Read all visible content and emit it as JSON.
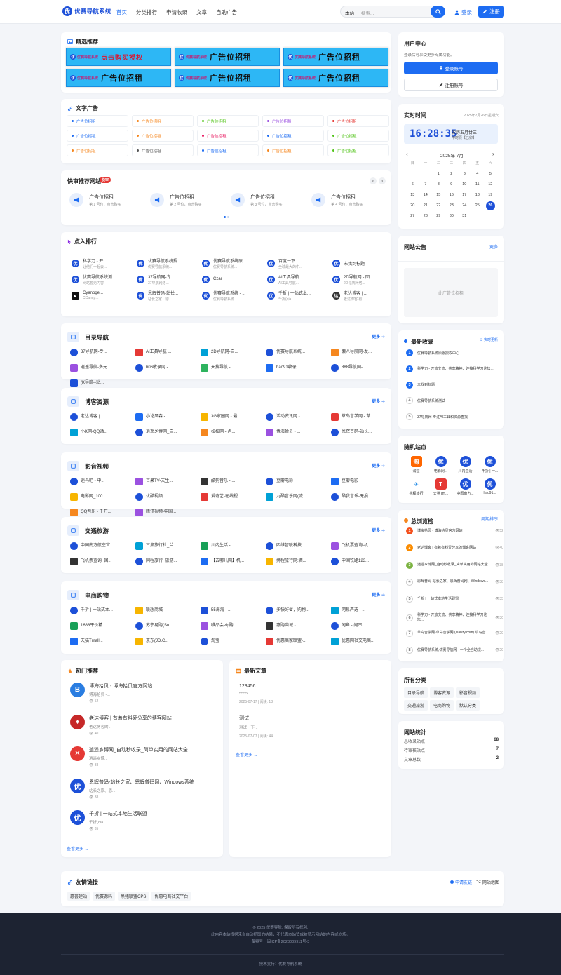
{
  "brand": {
    "name": "优赛导航系统",
    "icon": "优"
  },
  "nav": [
    "首页",
    "分类排行",
    "申请收录",
    "文章",
    "自助广告"
  ],
  "search": {
    "site": "本站",
    "placeholder": "搜索..."
  },
  "user": {
    "login": "登录",
    "register": "注册"
  },
  "featured": {
    "title": "精选推荐",
    "banners": [
      {
        "mini": "优赛导航系统",
        "text": "点击购买授权",
        "red": true
      },
      {
        "mini": "优赛导航系统",
        "text": "广告位招租"
      },
      {
        "mini": "优赛导航系统",
        "text": "广告位招租"
      },
      {
        "mini": "优赛导航系统",
        "text": "广告位招租"
      },
      {
        "mini": "优赛导航系统",
        "text": "广告位招租"
      },
      {
        "mini": "优赛导航系统",
        "text": "广告位招租"
      }
    ]
  },
  "textads": {
    "title": "文字广告",
    "label": "广告位招租",
    "dots": [
      "#1d6cf2",
      "#f5871f",
      "#52c41a",
      "#9b51e0",
      "#e53935",
      "#1d6cf2",
      "#f5871f",
      "#e91e63",
      "#1d6cf2",
      "#52c41a",
      "#f5871f",
      "#555",
      "#1d6cf2",
      "#f5871f",
      "#52c41a"
    ]
  },
  "quick": {
    "title": "快审推荐网站",
    "badge": "快审",
    "items": [
      {
        "t": "广告位招租",
        "s": "第 1 号位，点击购买"
      },
      {
        "t": "广告位招租",
        "s": "第 2 号位，点击购买"
      },
      {
        "t": "广告位招租",
        "s": "第 3 号位，点击购买"
      },
      {
        "t": "广告位招租",
        "s": "第 4 号位，点击购买"
      }
    ]
  },
  "rank": {
    "title": "点入排行",
    "items": [
      {
        "t": "科学刀 - 开...",
        "s": "让他们一起去..."
      },
      {
        "t": "优赛导航系统授...",
        "s": "优赛导航系统..."
      },
      {
        "t": "优赛导航系统原...",
        "s": "优赛导航系统..."
      },
      {
        "t": "百度一下",
        "s": "全球最大的中..."
      },
      {
        "t": "未找到标题",
        "s": ""
      },
      {
        "t": "优赛导航系统测...",
        "s": "网站暂无内容"
      },
      {
        "t": "37导航网-专...",
        "s": "37导航网络..."
      },
      {
        "t": "Czar",
        "s": ""
      },
      {
        "t": "AI工具导航 ...",
        "s": "AI工具导航..."
      },
      {
        "t": "2D导航网 - 回...",
        "s": "2D导航网络..."
      },
      {
        "t": "Cyanoge...",
        "s": "CCam p..."
      },
      {
        "t": "恩辉普码-站长...",
        "s": "站长之家、恩..."
      },
      {
        "t": "优赛导航系统 - ...",
        "s": "优赛导航系统..."
      },
      {
        "t": "千折 | 一站式本...",
        "s": "千折(qia..."
      },
      {
        "t": "老达博客 | ...",
        "s": "老达博客 有..."
      }
    ]
  },
  "sections": [
    {
      "title": "目录导航",
      "more": "更多",
      "items": [
        "37导航网-专...",
        "AI工具导航 ...",
        "2D导航网-自...",
        "优赛导航系统...",
        "懒人导航网-发...",
        "逍遥导航-多元...",
        "606收录网 - ...",
        "天搜导航 - ...",
        "hao91收录...",
        "888导航网-...",
        "(K导航--站..."
      ]
    },
    {
      "title": "博客资源",
      "more": "更多",
      "items": [
        "老达博客 | ...",
        "小论风森 - ...",
        "3G家园网 - 最...",
        "活动资讯网 - ...",
        "草岛音学网 - 草...",
        "小K网-QQ活...",
        "逍遥乡博网_自...",
        "松松网 - 卢...",
        "博海拾贝 - ...",
        "恩辉普码-站长..."
      ]
    },
    {
      "title": "影音视频",
      "more": "更多",
      "items": [
        "迷鸟吧 - 中...",
        "芒果TV-天生...",
        "酷狗音乐 - ...",
        "豆瓣电影",
        "豆瓣电影",
        "电影网_100...",
        "优酷视频",
        "爱奇艺-在线视...",
        "九酷音乐网(流...",
        "酷我音乐-无损...",
        "QQ音乐 - 千万...",
        "腾讯视频-中国..."
      ]
    },
    {
      "title": "交通旅游",
      "more": "更多",
      "items": [
        "中国南方航空官...",
        "甘肃旅行社_兰...",
        "川内生活 - ...",
        "四维智联科技",
        "飞机票查询-机...",
        "飞机票查询_国...",
        "同程旅行_旅游...",
        "【去哪儿网】机...",
        "携程旅行网:酒...",
        "中国铁路123..."
      ]
    },
    {
      "title": "电商购物",
      "more": "更多",
      "items": [
        "千折 | 一站式本...",
        "联想商城",
        "55海淘 - ...",
        "多快好省，购物...",
        "网易严选 - ...",
        "1688平价精...",
        "苏宁易购(Su...",
        "唯品会vip购...",
        "惠购商城 - ...",
        "闲鱼 - 闲不...",
        "天猫Tmall...",
        "京东(JD.C...",
        "淘宝",
        "优惠商家联盟-...",
        "优惠网社交电商..."
      ]
    }
  ],
  "hot": {
    "title": "热门推荐",
    "more": "查看更多 →",
    "items": [
      {
        "t": "博海拾贝 - 博海拾贝官方网站",
        "s": "博海拾贝 -...",
        "v": "52"
      },
      {
        "t": "老达博客 | 有着有料爱分享的博客网站",
        "s": "老达博客的...",
        "v": "40"
      },
      {
        "t": "逍遥乡博网_自动秒收录_简单实用的网站大全",
        "s": "逍遥乡博...",
        "v": "38"
      },
      {
        "t": "恩辉普码-站长之家、恩辉普码网、Windows系统",
        "s": "站长之家、恩...",
        "v": "38"
      },
      {
        "t": "千折 | 一站式本地生活联盟",
        "s": "千折(qia...",
        "v": "35"
      }
    ]
  },
  "articles": {
    "title": "最新文章",
    "more": "查看更多 →",
    "items": [
      {
        "t": "123456",
        "s": "5555...",
        "d": "2025-07-17",
        "r": "阅读: 18"
      },
      {
        "t": "测试",
        "s": "测试一下...",
        "d": "2025-07-07",
        "r": "阅读: 44"
      }
    ]
  },
  "usercenter": {
    "title": "用户中心",
    "desc": "登录后可享受更多专属功能。",
    "login": "登录账号",
    "register": "注册账号"
  },
  "clock": {
    "title": "实时时间",
    "date": "2025年7月26日星期六",
    "time": "16:28:35",
    "lunar": "农历五月廿三",
    "shi": "申时辰【己卯】",
    "month": "2025年 7月",
    "weekdays": [
      "日",
      "一",
      "二",
      "三",
      "四",
      "五",
      "六"
    ],
    "today": 26
  },
  "notice": {
    "title": "网站公告",
    "more": "更多",
    "ad": "此广告位招租"
  },
  "latest": {
    "title": "最新收录",
    "refresh": "实时更新",
    "items": [
      "优赛导航系统原版授权中心",
      "科学刀 - 开放交流、共享精神、连接科学刀论坛...",
      "未找到标题",
      "优赛导航系统测试",
      "37导航网-专注AI工具和资源查找"
    ]
  },
  "random": {
    "title": "随机站点",
    "items": [
      "淘宝",
      "电影网...",
      "川内生活",
      "千折 | 一...",
      "携程旅行",
      "天猫Tm...",
      "中国南方...",
      "hao91..."
    ]
  },
  "hotlist": {
    "title": "总浏览榜",
    "more": "周期排序",
    "items": [
      {
        "t": "博海拾贝 - 博海拾贝官方网站",
        "v": "52"
      },
      {
        "t": "老达博客 | 有着有料爱分享的博客网站",
        "v": "40"
      },
      {
        "t": "逍遥乡博网_自动秒收录_简单实用的网站大全",
        "v": "38"
      },
      {
        "t": "恩辉普码-站长之家、恩辉普码网、Windows...",
        "v": "38"
      },
      {
        "t": "千折 | 一站式本地生活联盟",
        "v": "35"
      },
      {
        "t": "科学刀 - 开放交流、共享精神、连接科学刀论坛...",
        "v": "30"
      },
      {
        "t": "草岛音学网-草岛音学网 (cianzy.com) 草岛音...",
        "v": "29"
      },
      {
        "t": "优赛导航系统,优赛导航网 - 一个全自助提...",
        "v": "29"
      }
    ]
  },
  "categories": {
    "title": "所有分类",
    "items": [
      "目录导航",
      "博客资源",
      "影音视频",
      "交通旅游",
      "电商购物",
      "默认分类"
    ]
  },
  "stats": {
    "title": "网站统计",
    "items": [
      {
        "k": "总收录站点",
        "v": "68"
      },
      {
        "k": "待审核站点",
        "v": "7"
      },
      {
        "k": "文章总数",
        "v": "2"
      }
    ]
  },
  "friends": {
    "title": "友情链接",
    "apply": "申请友链",
    "sitemap": "网站地图",
    "items": [
      "惠芸建站",
      "优赛源码",
      "黑猪联盟CPS",
      "优惠电商社交平台"
    ]
  },
  "footer": {
    "l1": "© 2025 优赛导航. 保留所有权利.",
    "l2": "此内容本站根据来自自动抓取的结果，不代表本站赞成被显示网站的内容或立场。",
    "l3": "备案号：闽ICP备2023009911号-3",
    "l4": "技术支持：优赛导航系统"
  },
  "colors": {
    "primary": "#1d6cf2",
    "bg": "#f3f5f9",
    "footer": "#1d2332"
  }
}
